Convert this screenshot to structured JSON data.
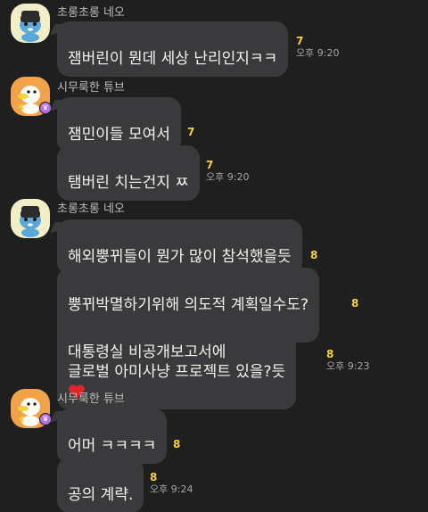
{
  "messages": [
    {
      "sender": "초롱초롱 네오",
      "bubbles": [
        {
          "text": "잼버린이 뭔데 세상 난리인지ㅋㅋ",
          "unread": "7",
          "time": "오후 9:20"
        }
      ]
    },
    {
      "sender": "시무룩한 튜브",
      "bubbles": [
        {
          "text": "잼민이들 모여서",
          "unread": "7",
          "time": ""
        },
        {
          "text": "탬버린 치는건지 ㅉ",
          "unread": "7",
          "time": "오후 9:20"
        }
      ]
    },
    {
      "sender": "초롱초롱 네오",
      "bubbles": [
        {
          "text": "해외뿡뀌들이 뭔가 많이 참석했을듯",
          "unread": "8",
          "time": ""
        },
        {
          "text": "뿡뀌박멸하기위해 의도적 계획일수도?",
          "unread": "8",
          "time": ""
        },
        {
          "text": "대통령실 비공개보고서에\n글로벌 아미사냥 프로젝트 있을?듯",
          "unread": "8",
          "time": "오후 9:23"
        }
      ]
    },
    {
      "sender": "시무룩한 튜브",
      "bubbles": [
        {
          "text": "어머 ㅋㅋㅋㅋ",
          "unread": "8",
          "time": ""
        },
        {
          "text": "공의 계략.",
          "unread": "8",
          "time": "오후 9:24"
        }
      ]
    }
  ],
  "icons": {
    "neo_avatar": "neo-character",
    "tube_avatar": "tube-duck-character",
    "crown": "crown-badge",
    "thinking_emoji": "face-with-hand-over-mouth",
    "heart_emoji": "red-heart"
  },
  "colors": {
    "background": "#1f1f1f",
    "bubble": "#3a3a3c",
    "unread": "#f6d23c",
    "crown": "#b76fe0",
    "heart": "#e0252b"
  }
}
